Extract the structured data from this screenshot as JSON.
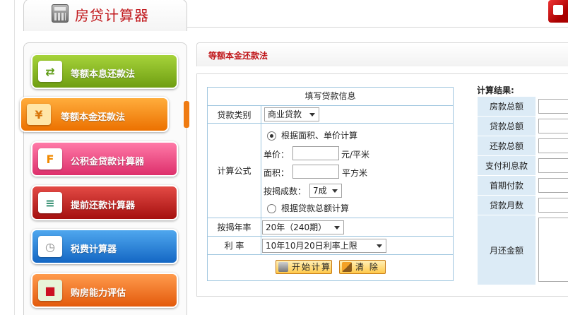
{
  "header": {
    "title": "房贷计算器",
    "icon": "calculator-icon",
    "corner_logo_icon": "app-logo-icon",
    "title_color": "#c0161a"
  },
  "sidebar": {
    "items": [
      {
        "label": "等额本息还款法",
        "icon": "swap-arrows-icon",
        "color": "#8cbc24",
        "active": false
      },
      {
        "label": "等额本金还款法",
        "icon": "money-icon",
        "color": "#f58a12",
        "active": true
      },
      {
        "label": "公积金贷款计算器",
        "icon": "fund-icon",
        "color": "#ea4a84",
        "active": false
      },
      {
        "label": "提前还款计算器",
        "icon": "notes-icon",
        "color": "#c22520",
        "active": false
      },
      {
        "label": "税费计算器",
        "icon": "clock-icon",
        "color": "#2a83dc",
        "active": false
      },
      {
        "label": "购房能力评估",
        "icon": "shopping-bags-icon",
        "color": "#f07420",
        "active": false
      }
    ]
  },
  "main": {
    "section_title": "等额本金还款法"
  },
  "form": {
    "header": "填写贷款信息",
    "loan_type": {
      "label": "贷款类别",
      "value": "商业贷款"
    },
    "calc_method": {
      "label": "计算公式",
      "option_area": "根据面积、单价计算",
      "unit_price_label": "单价：",
      "unit_price_value": "",
      "unit_price_unit": "元/平米",
      "area_label": "面积：",
      "area_value": "",
      "area_unit": "平方米",
      "ratio_label": "按揭成数：",
      "ratio_value": "7成",
      "option_total": "根据贷款总额计算",
      "selected": "area"
    },
    "term": {
      "label": "按揭年率",
      "value": "20年（240期）"
    },
    "rate": {
      "label": "利 率",
      "value": "10年10月20日利率上限"
    },
    "buttons": {
      "calculate": "开始计算",
      "clear": "清 除"
    }
  },
  "results": {
    "title": "计算结果:",
    "fields": [
      {
        "label": "房款总额",
        "value": ""
      },
      {
        "label": "贷款总额",
        "value": ""
      },
      {
        "label": "还款总额",
        "value": ""
      },
      {
        "label": "支付利息款",
        "value": ""
      },
      {
        "label": "首期付款",
        "value": ""
      },
      {
        "label": "贷款月数",
        "value": ""
      },
      {
        "label": "月还金额",
        "value": ""
      }
    ]
  }
}
